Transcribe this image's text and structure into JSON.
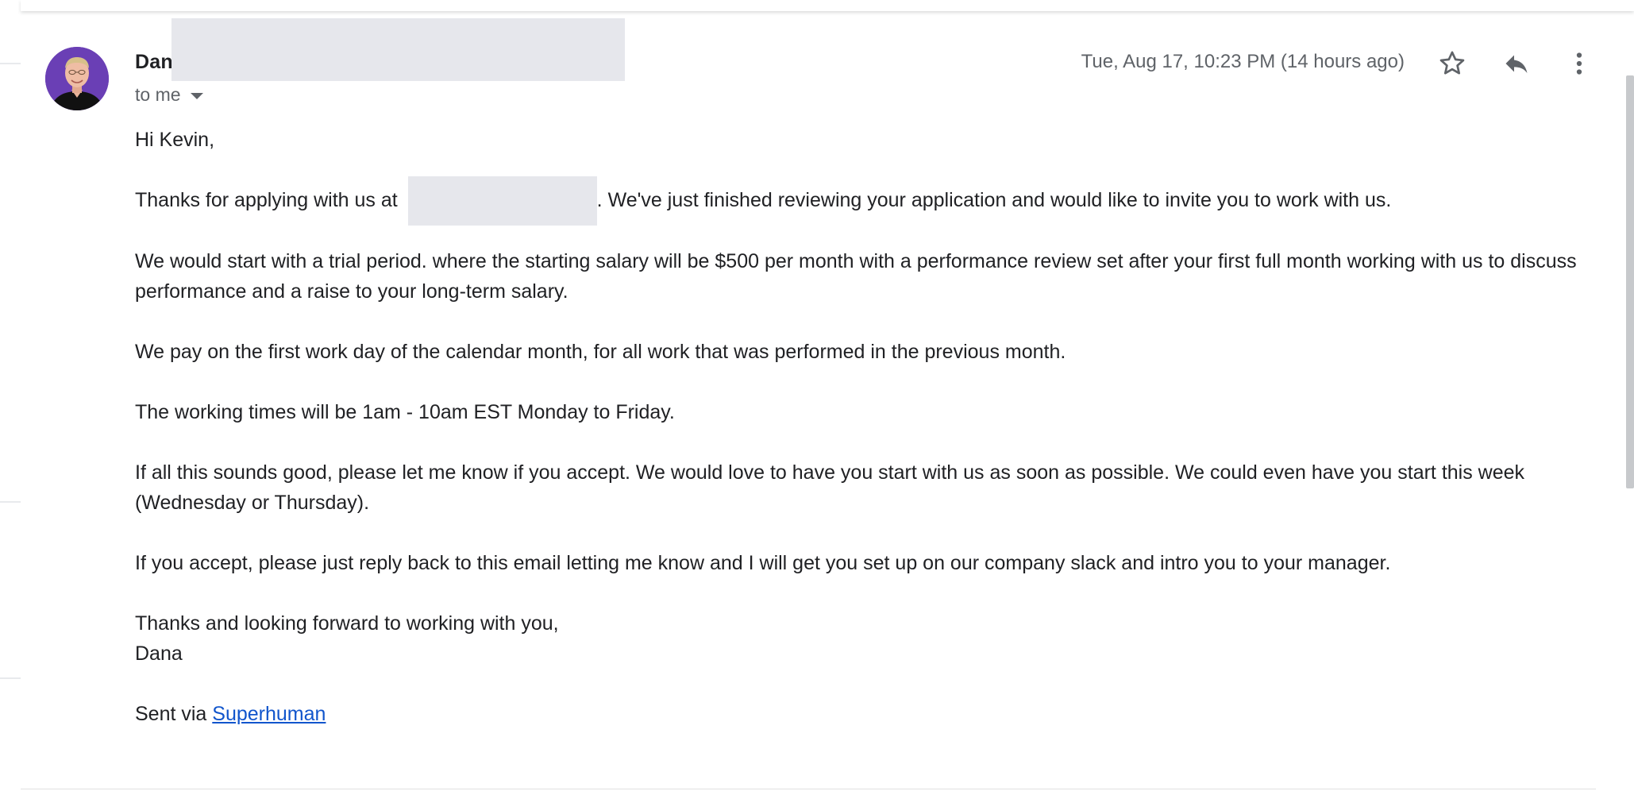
{
  "message": {
    "sender_name": "Dan",
    "recipient_label": "to me",
    "timestamp": "Tue, Aug 17, 10:23 PM (14 hours ago)",
    "icons": {
      "star": "star-outline-icon",
      "reply": "reply-icon",
      "more": "more-vert-icon"
    },
    "body": {
      "greeting": "Hi Kevin,",
      "p1_before": "Thanks for applying with us at ",
      "p1_after": ". We've just finished reviewing your application and would like to invite you to work with us.",
      "p2": "We would start with a trial period. where the starting salary will be $500 per month with a performance review set after your first full month working with us to discuss performance and a raise to your long-term salary.",
      "p3": "We pay on the first work day of the calendar month, for all work that was performed in the previous month.",
      "p4": "The working times will be 1am - 10am EST Monday to Friday.",
      "p5": "If all this sounds good, please let me know if you accept. We would love to have you start with us as soon as possible. We could even have you start this week (Wednesday or Thursday).",
      "p6": "If you accept, please just reply back to this email letting me know and I will get you set up on our company slack and intro you to your manager.",
      "closing": "Thanks and looking forward to working with you,",
      "signature": "Dana",
      "sent_via_prefix": "Sent via ",
      "sent_via_link": "Superhuman"
    }
  },
  "colors": {
    "avatar_bg": "#6a3fb5",
    "link": "#1155cc",
    "redaction": "#e6e7ec",
    "secondary_text": "#5f6368"
  }
}
